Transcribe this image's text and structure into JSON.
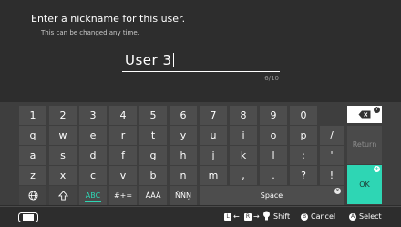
{
  "header": {
    "prompt": "Enter a nickname for this user.",
    "subprompt": "This can be changed any time.",
    "name_value": "User 3",
    "counter": "6/10"
  },
  "keyboard": {
    "row_numbers": [
      "1",
      "2",
      "3",
      "4",
      "5",
      "6",
      "7",
      "8",
      "9",
      "0"
    ],
    "row_top": [
      "q",
      "w",
      "e",
      "r",
      "t",
      "y",
      "u",
      "i",
      "o",
      "p"
    ],
    "row_top_extra": "/",
    "row_home": [
      "a",
      "s",
      "d",
      "f",
      "g",
      "h",
      "j",
      "k",
      "l",
      ":"
    ],
    "row_home_extra": "'",
    "row_bottom": [
      "z",
      "x",
      "c",
      "v",
      "b",
      "n",
      "m",
      ",",
      ".",
      "?"
    ],
    "row_bottom_extra": "!",
    "mode_abc": "ABC",
    "mode_symbols": "#+=",
    "mode_accents": "ÀÁÂ",
    "mode_special": "ŇŃŅ",
    "space_label": "Space",
    "return_label": "Return",
    "ok_label": "OK"
  },
  "footer": {
    "l_hint": "←",
    "r_hint": "→",
    "shift_label": "Shift",
    "cancel_label": "Cancel",
    "select_label": "Select"
  },
  "colors": {
    "accent": "#2ed6b4",
    "background": "#2d2d2d",
    "keyboard": "#3e3e3e"
  }
}
